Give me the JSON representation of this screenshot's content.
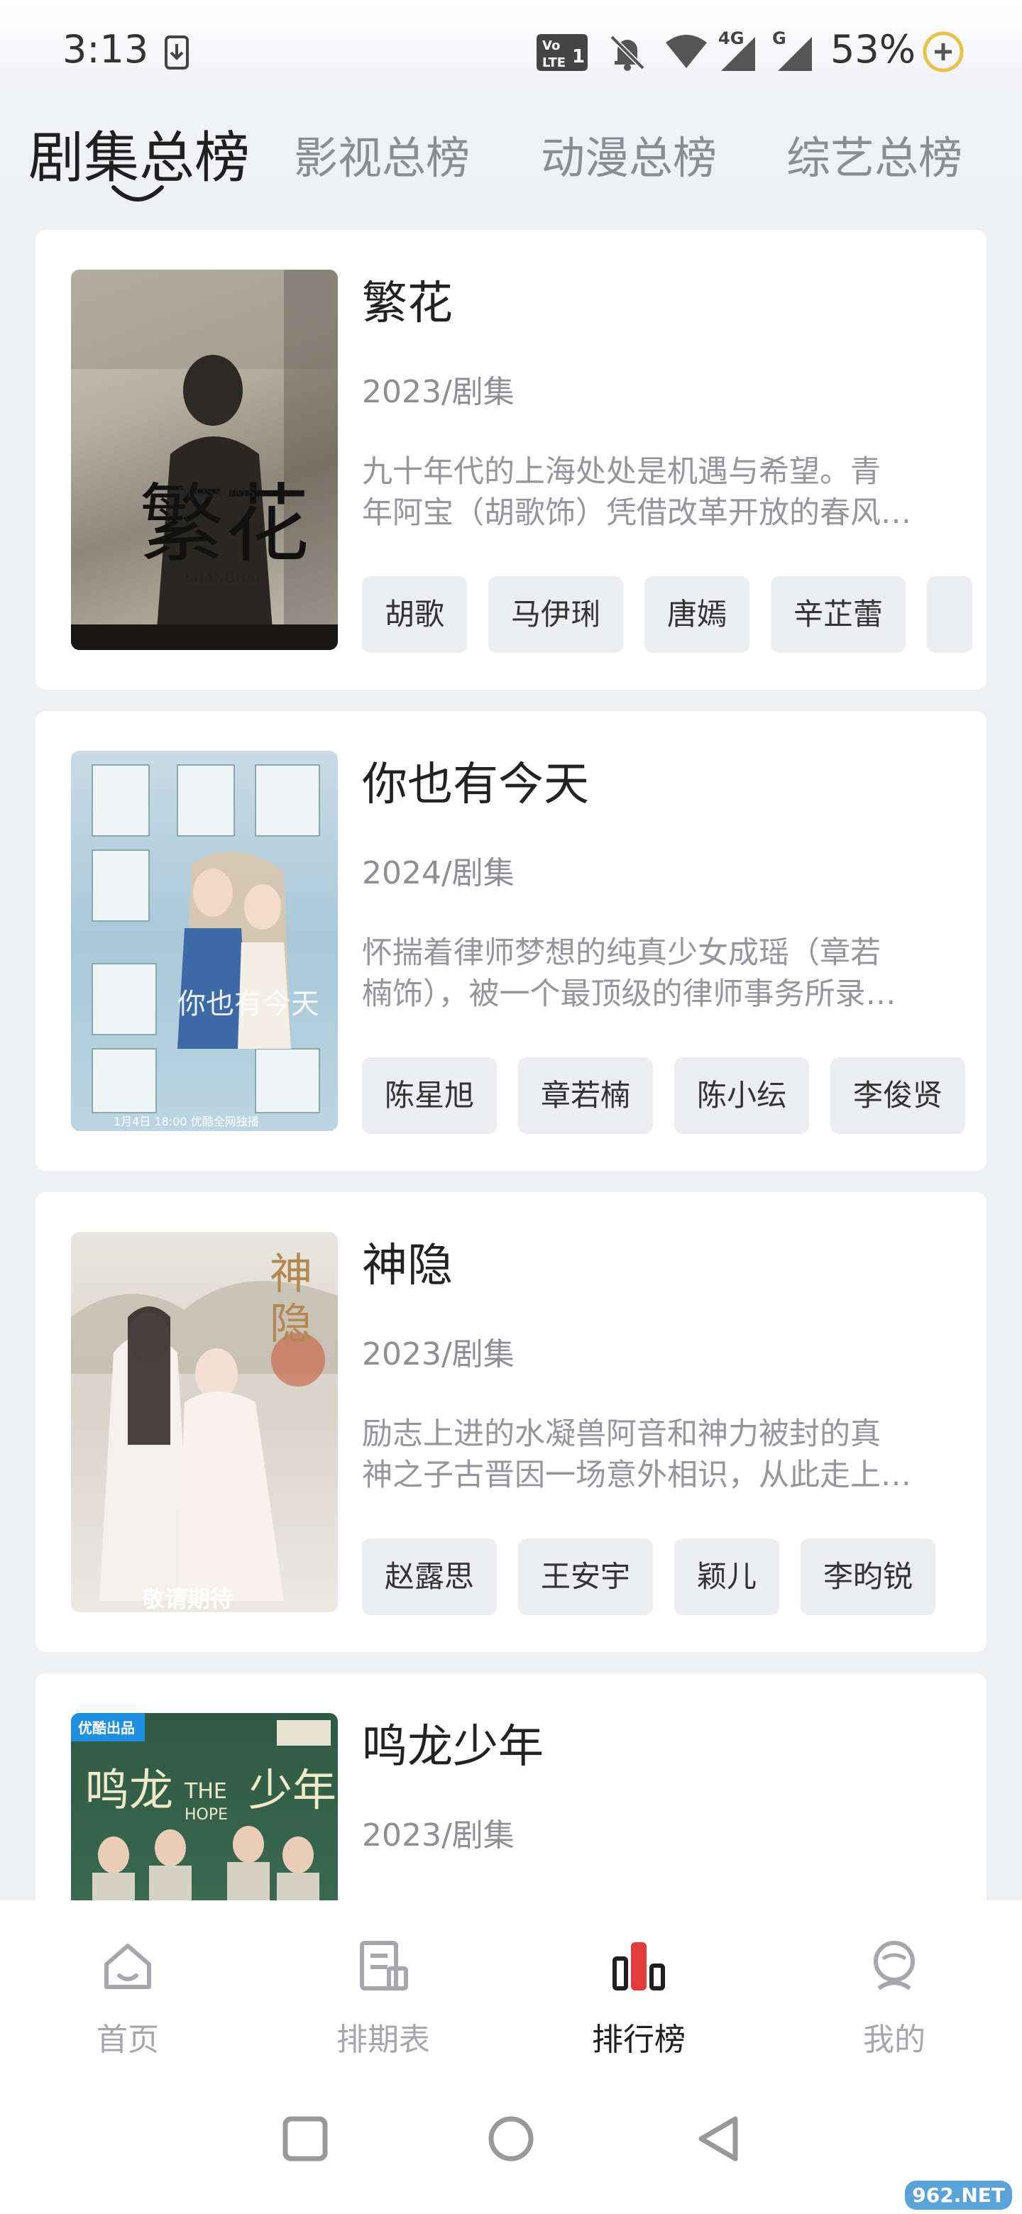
{
  "status_bar": {
    "time": "3:13",
    "battery": "53%",
    "network_4g": "4G",
    "network_g": "G"
  },
  "tabs": [
    {
      "label": "剧集总榜",
      "active": true
    },
    {
      "label": "影视总榜",
      "active": false
    },
    {
      "label": "动漫总榜",
      "active": false
    },
    {
      "label": "综艺总榜",
      "active": false
    }
  ],
  "cards": [
    {
      "title": "繁花",
      "year": "2023/剧集",
      "desc_lines": [
        "九十年代的上海处处是机遇与希望。青",
        "年阿宝（胡歌饰）凭借改革开放的春风…"
      ],
      "tags": [
        "胡歌",
        "马伊琍",
        "唐嫣",
        "辛芷蕾"
      ],
      "poster_text": "繁花",
      "poster_sub": "BLOSSOMS SHANGHAI"
    },
    {
      "title": "你也有今天",
      "year": "2024/剧集",
      "desc_lines": [
        "怀揣着律师梦想的纯真少女成瑶（章若",
        "楠饰），被一个最顶级的律师事务所录…"
      ],
      "tags": [
        "陈星旭",
        "章若楠",
        "陈小纭",
        "李俊贤"
      ],
      "poster_text": "你也有今天",
      "poster_sub": "1月4日 18:00 优酷全网独播"
    },
    {
      "title": "神隐",
      "year": "2023/剧集",
      "desc_lines": [
        "励志上进的水凝兽阿音和神力被封的真",
        "神之子古晋因一场意外相识，从此走上…"
      ],
      "tags": [
        "赵露思",
        "王安宇",
        "颖儿",
        "李昀锐"
      ],
      "poster_text": "神隐",
      "poster_sub": "敬请期待"
    },
    {
      "title": "鸣龙少年",
      "year": "2023/剧集",
      "desc_lines": [
        "",
        ""
      ],
      "tags": [],
      "poster_text": "鸣龙少年",
      "poster_sub": "THE HOPE",
      "poster_badge": "优酷出品"
    }
  ],
  "bottom_nav": [
    {
      "label": "首页",
      "icon": "home-icon",
      "active": false
    },
    {
      "label": "排期表",
      "icon": "schedule-icon",
      "active": false
    },
    {
      "label": "排行榜",
      "icon": "ranking-icon",
      "active": true
    },
    {
      "label": "我的",
      "icon": "profile-icon",
      "active": false
    }
  ],
  "watermark": "962.NET",
  "colors": {
    "active_text": "#1f1f1f",
    "inactive_text": "#8b8d93",
    "tag_bg": "#edeef2",
    "page_bg": "#eef0f4"
  }
}
